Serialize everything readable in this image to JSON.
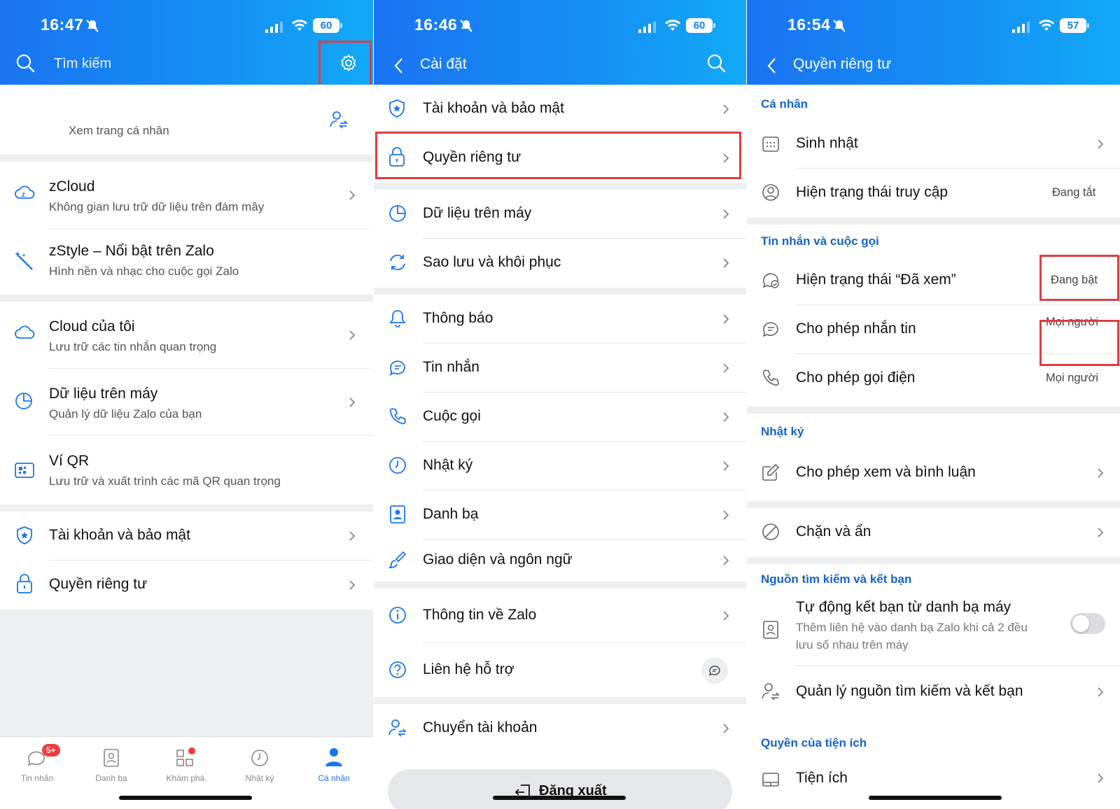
{
  "panel1": {
    "status": {
      "time": "16:47",
      "battery": "60"
    },
    "search_label": "Tìm kiếm",
    "profile_link": "Xem trang cá nhân",
    "items": [
      {
        "title": "zCloud",
        "subtitle": "Không gian lưu trữ dữ liệu trên đám mây",
        "icon": "zcloud-icon"
      },
      {
        "title": "zStyle – Nổi bật trên Zalo",
        "subtitle": "Hình nền và nhạc cho cuộc gọi Zalo",
        "icon": "magic-wand-icon"
      },
      {
        "title": "Cloud của tôi",
        "subtitle": "Lưu trữ các tin nhắn quan trọng",
        "icon": "cloud-icon"
      },
      {
        "title": "Dữ liệu trên máy",
        "subtitle": "Quản lý dữ liệu Zalo của bạn",
        "icon": "pie-chart-icon"
      },
      {
        "title": "Ví QR",
        "subtitle": "Lưu trữ và xuất trình các mã QR quan trọng",
        "icon": "qr-wallet-icon"
      },
      {
        "title": "Tài khoản và bảo mật",
        "icon": "shield-icon"
      },
      {
        "title": "Quyền riêng tư",
        "icon": "lock-icon"
      }
    ],
    "tabs": [
      {
        "label": "Tin nhắn",
        "badge": "5+"
      },
      {
        "label": "Danh bạ"
      },
      {
        "label": "Khám phá"
      },
      {
        "label": "Nhật ký"
      },
      {
        "label": "Cá nhân"
      }
    ]
  },
  "panel2": {
    "status": {
      "time": "16:46",
      "battery": "60"
    },
    "title": "Cài đặt",
    "items": [
      {
        "label": "Tài khoản và bảo mật",
        "icon": "shield-icon"
      },
      {
        "label": "Quyền riêng tư",
        "icon": "lock-icon"
      },
      {
        "label": "Dữ liệu trên máy",
        "icon": "pie-chart-icon"
      },
      {
        "label": "Sao lưu và khôi phục",
        "icon": "sync-icon"
      },
      {
        "label": "Thông báo",
        "icon": "bell-icon"
      },
      {
        "label": "Tin nhắn",
        "icon": "chat-icon"
      },
      {
        "label": "Cuộc gọi",
        "icon": "phone-icon"
      },
      {
        "label": "Nhật ký",
        "icon": "clock-icon"
      },
      {
        "label": "Danh bạ",
        "icon": "contacts-icon"
      },
      {
        "label": "Giao diện và ngôn ngữ",
        "icon": "brush-icon"
      },
      {
        "label": "Thông tin về Zalo",
        "icon": "info-icon"
      },
      {
        "label": "Liên hệ hỗ trợ",
        "icon": "help-icon"
      },
      {
        "label": "Chuyển tài khoản",
        "icon": "switch-account-icon"
      }
    ],
    "logout_label": "Đăng xuất"
  },
  "panel3": {
    "status": {
      "time": "16:54",
      "battery": "57"
    },
    "title": "Quyền riêng tư",
    "sections": {
      "personal": "Cá nhân",
      "messages_calls": "Tin nhắn và cuộc gọi",
      "diary": "Nhật ký",
      "search_friend": "Nguồn tìm kiếm và kết bạn",
      "utilities": "Quyền của tiện ích"
    },
    "rows": {
      "birthday": "Sinh nhật",
      "access_status": {
        "label": "Hiện trạng thái truy cập",
        "value": "Đang tắt"
      },
      "seen_status": {
        "label": "Hiện trạng thái “Đã xem”",
        "value": "Đang bật"
      },
      "allow_message": {
        "label": "Cho phép nhắn tin",
        "value": "Mọi người"
      },
      "allow_call": {
        "label": "Cho phép gọi điện",
        "value": "Mọi người"
      },
      "allow_view_comment": "Cho phép xem và bình luận",
      "block_hide": "Chặn và ẩn",
      "auto_friend": {
        "label": "Tự động kết bạn từ danh bạ máy",
        "desc1": "Thêm liên hệ vào danh bạ Zalo khi cả 2 đều",
        "desc2": "lưu số nhau trên máy",
        "enabled": false
      },
      "manage_sources": "Quản lý nguồn tìm kiếm và kết bạn",
      "utilities": "Tiện ích"
    }
  },
  "colors": {
    "header": "#1a7ef3",
    "accent": "#1464c8",
    "highlight": "#e03c40"
  }
}
